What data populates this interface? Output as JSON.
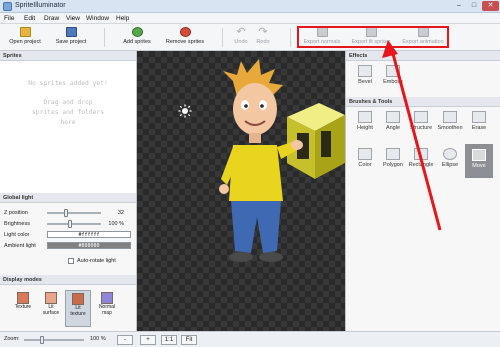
{
  "window": {
    "title": "SpriteIlluminator",
    "minimize": "–",
    "maximize": "□",
    "close": "✕"
  },
  "menu": [
    "File",
    "Edit",
    "Draw",
    "View",
    "Window",
    "Help"
  ],
  "toolbar": {
    "open_project": "Open project",
    "save_project": "Save project",
    "add_sprites": "Add sprites",
    "remove_sprites": "Remove sprites",
    "undo": "Undo",
    "redo": "Redo",
    "export_normals": "Export normals",
    "export_lit_sprites": "Export lit sprites",
    "export_animation": "Export animation"
  },
  "sprites_panel": {
    "header": "Sprites",
    "empty_line1": "No sprites added yet!",
    "empty_line2": "Drag and drop",
    "empty_line3": "sprites and folders",
    "empty_line4": "here"
  },
  "global_light": {
    "header": "Global light",
    "z_position_label": "Z position",
    "z_position_value": "32",
    "z_position_level": 0.35,
    "brightness_label": "Brightness",
    "brightness_value": "100 %",
    "brightness_level": 0.42,
    "light_color_label": "Light color",
    "light_color_value": "#ffffff",
    "ambient_light_label": "Ambient light",
    "ambient_light_value": "#808080",
    "auto_rotate_label": "Auto-rotate light"
  },
  "display_modes": {
    "header": "Display modes",
    "items": [
      "Texture",
      "Lit\nsurface",
      "Lit\ntexture",
      "Normal\nmap"
    ],
    "active_index": 2
  },
  "effects": {
    "header": "Effects",
    "items": [
      "Bevel",
      "Emboss"
    ]
  },
  "brushes": {
    "header": "Brushes & Tools",
    "row1": [
      "Height",
      "Angle",
      "Structure",
      "Smoothen",
      "Erase"
    ],
    "row2": [
      "Color",
      "Polygon",
      "Rectangle",
      "Ellipse",
      "Move"
    ],
    "selected": "Move"
  },
  "status": {
    "zoom_label": "Zoom:",
    "zoom_value": "100 %",
    "zoom_level": 0.3,
    "minus": "-",
    "plus": "+",
    "one_to_one": "1:1",
    "fit": "Fit"
  },
  "colors": {
    "highlight": "#e6161c",
    "canvas_dark": "#2a2a2a",
    "canvas_light": "#383838",
    "light_color": "#ffffff",
    "ambient_color": "#808080"
  }
}
